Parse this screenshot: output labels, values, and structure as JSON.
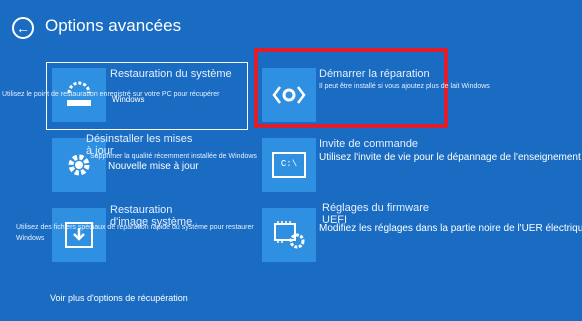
{
  "header": {
    "title": "Options avancées"
  },
  "options": [
    {
      "label": "Restauration du système",
      "desc_small": "Utilisez le point de restauration enregistré sur votre PC pour récupérer",
      "desc_big": "Windows",
      "icon": "restore-icon"
    },
    {
      "label": "Démarrer la réparation",
      "desc_small": "Il peut être installé si vous ajoutez plus de lait Windows",
      "icon": "repair-icon"
    },
    {
      "label": "Désinstaller les mises à jour",
      "desc_small": "Supprimer la qualité récemment installée de Windows",
      "desc_big": "Nouvelle mise à jour",
      "icon": "gear-icon"
    },
    {
      "label": "Invite de commande",
      "desc_big": "Utilisez l'invite de vie pour le dépannage de l'enseignement",
      "icon": "command-prompt-icon"
    },
    {
      "label": "Restauration d'image système",
      "desc_small": "Utilisez des fichiers spéciaux de réparation rapide du système pour restaurer Windows",
      "icon": "download-icon"
    },
    {
      "label": "Réglages du firmware UEFI",
      "desc_big": "Modifiez les réglages dans la partie noire de l'UER électrique",
      "icon": "firmware-settings-icon"
    }
  ],
  "footer": {
    "more_options": "Voir plus d'options de récupération"
  }
}
